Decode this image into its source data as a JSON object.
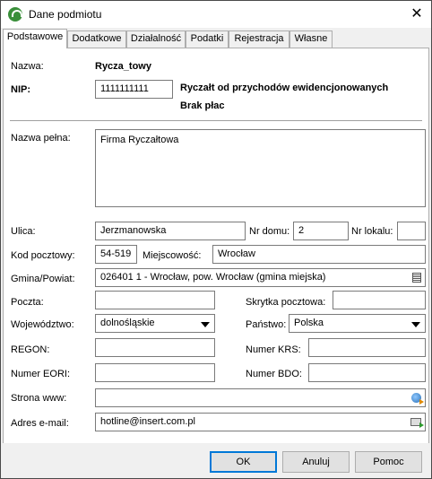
{
  "window": {
    "title": "Dane podmiotu",
    "close_glyph": "✕"
  },
  "tabs": [
    {
      "label": "Podstawowe",
      "active": true
    },
    {
      "label": "Dodatkowe",
      "active": false
    },
    {
      "label": "Działalność",
      "active": false
    },
    {
      "label": "Podatki",
      "active": false
    },
    {
      "label": "Rejestracja",
      "active": false
    },
    {
      "label": "Własne",
      "active": false
    }
  ],
  "form": {
    "nazwa_label": "Nazwa:",
    "nazwa_value": "Rycza_towy",
    "nip_label": "NIP:",
    "nip_value": "1111111111",
    "info_line1": "Ryczałt od przychodów ewidencjonowanych",
    "info_line2": "Brak płac",
    "nazwa_pelna_label": "Nazwa pełna:",
    "nazwa_pelna_value": "Firma Ryczałtowa",
    "ulica_label": "Ulica:",
    "ulica_value": "Jerzmanowska",
    "nr_domu_label": "Nr domu:",
    "nr_domu_value": "2",
    "nr_lokalu_label": "Nr lokalu:",
    "nr_lokalu_value": "",
    "kod_label": "Kod pocztowy:",
    "kod_value": "54-519",
    "miejscowosc_label": "Miejscowość:",
    "miejscowosc_value": "Wrocław",
    "gmina_label": "Gmina/Powiat:",
    "gmina_value": "026401 1 - Wrocław, pow. Wrocław (gmina miejska)",
    "poczta_label": "Poczta:",
    "poczta_value": "",
    "skrytka_label": "Skrytka pocztowa:",
    "skrytka_value": "",
    "wojewodztwo_label": "Województwo:",
    "wojewodztwo_value": "dolnośląskie",
    "panstwo_label": "Państwo:",
    "panstwo_value": "Polska",
    "regon_label": "REGON:",
    "regon_value": "",
    "krs_label": "Numer KRS:",
    "krs_value": "",
    "eori_label": "Numer EORI:",
    "eori_value": "",
    "bdo_label": "Numer BDO:",
    "bdo_value": "",
    "www_label": "Strona www:",
    "www_value": "",
    "email_label": "Adres e-mail:",
    "email_value": "hotline@insert.com.pl"
  },
  "buttons": {
    "ok": "OK",
    "cancel": "Anuluj",
    "help": "Pomoc"
  },
  "icons": {
    "app": "app-logo-icon",
    "gmina_lookup": "list-icon",
    "www_open": "globe-icon",
    "email_send": "mail-icon"
  }
}
